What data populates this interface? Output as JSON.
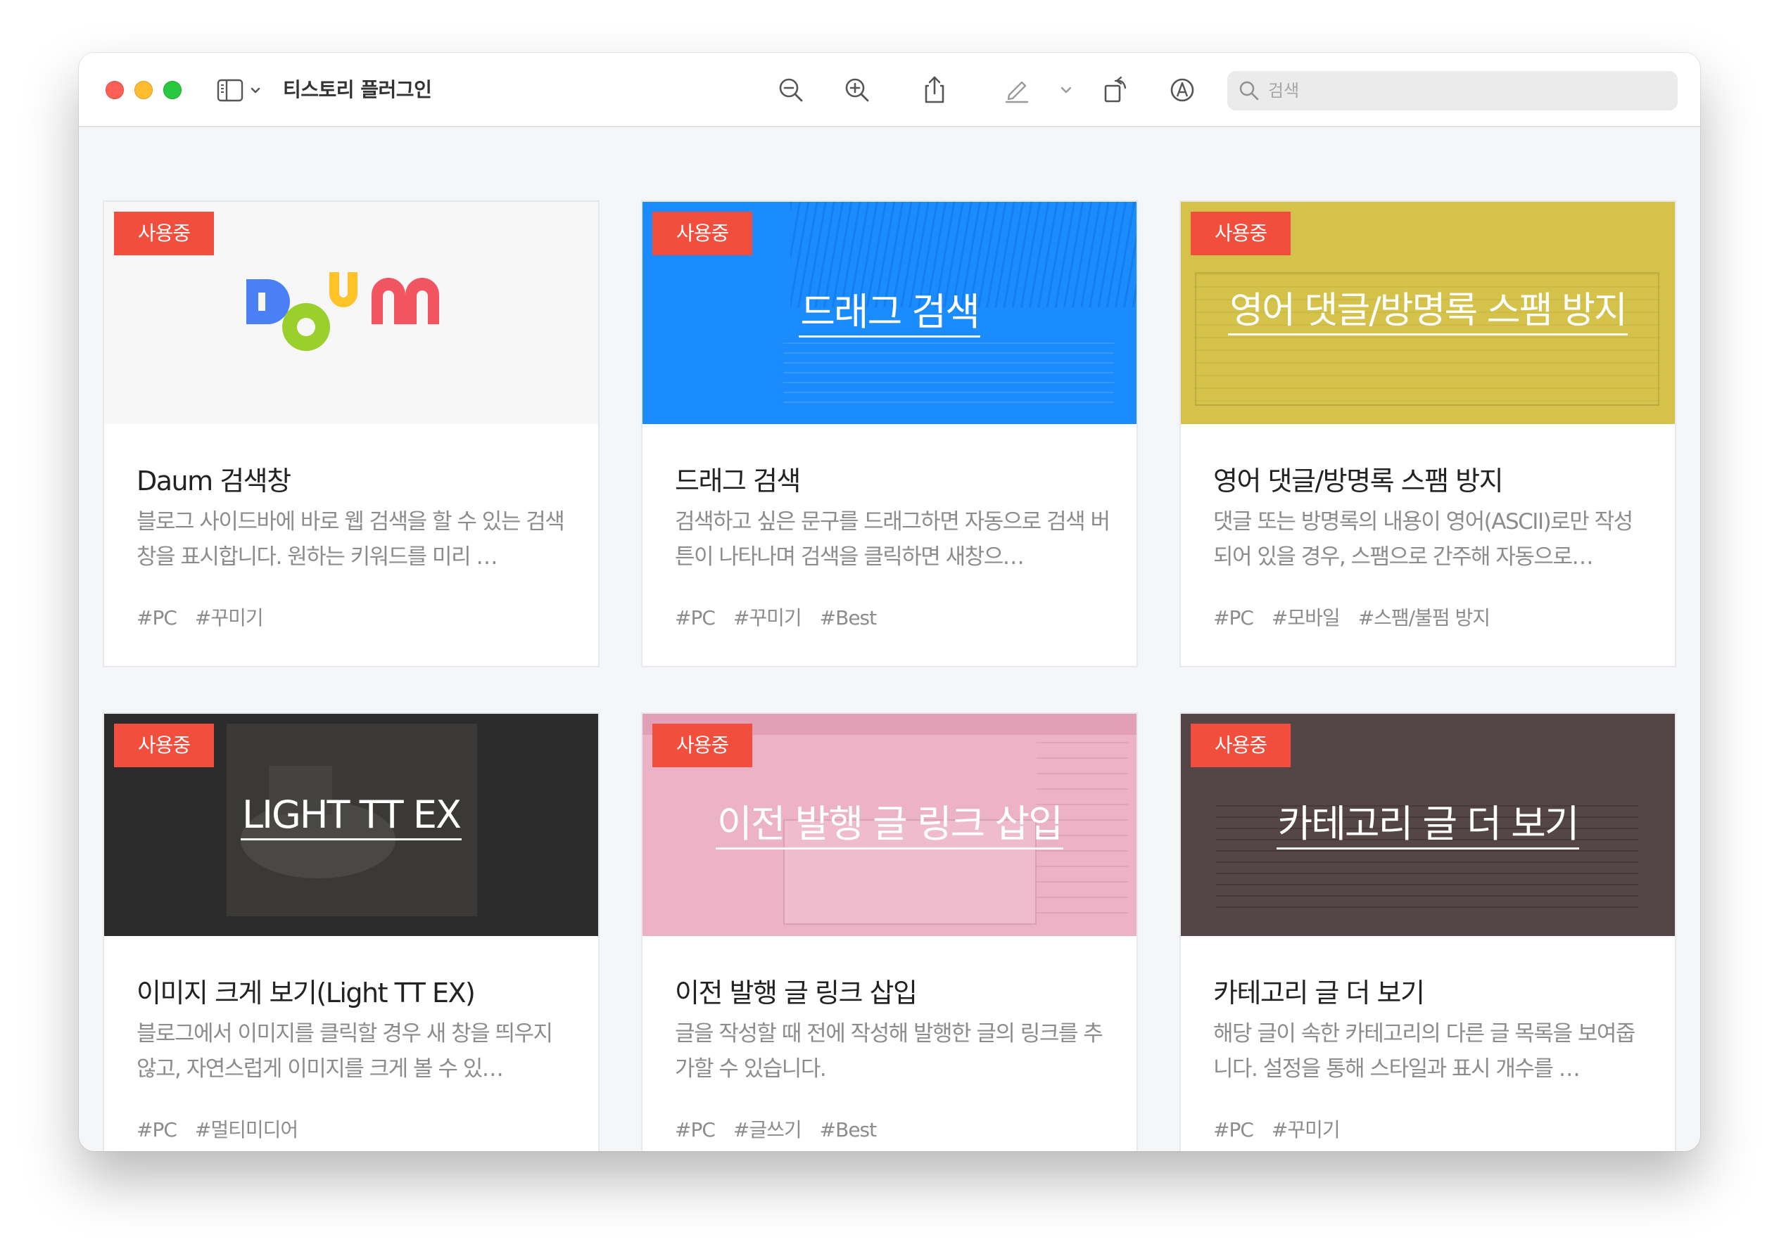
{
  "window": {
    "title": "티스토리 플러그인"
  },
  "search": {
    "placeholder": "검색"
  },
  "toolbar": {
    "icons": [
      "sidebar-icon",
      "zoom-out-icon",
      "zoom-in-icon",
      "share-icon",
      "highlight-icon",
      "rotate-icon",
      "markup-icon",
      "search-icon"
    ]
  },
  "colors": {
    "badge": "#f24e3e",
    "drag_bg": "#1a8cff",
    "spam_bg": "#d4c24a",
    "light_bg": "#2c2c2c",
    "link_bg": "#ecb3c7",
    "category_bg": "#544646"
  },
  "cards": [
    {
      "badge": "사용중",
      "thumb_logo": "Daum",
      "title": "Daum 검색창",
      "desc": "블로그 사이드바에 바로 웹 검색을 할 수 있는 검색창을 표시합니다. 원하는 키워드를 미리 …",
      "tags": [
        "#PC",
        "#꾸미기"
      ]
    },
    {
      "badge": "사용중",
      "thumb_title": "드래그 검색",
      "title": "드래그 검색",
      "desc": "검색하고 싶은 문구를 드래그하면 자동으로 검색 버튼이 나타나며 검색을 클릭하면 새창으…",
      "tags": [
        "#PC",
        "#꾸미기",
        "#Best"
      ]
    },
    {
      "badge": "사용중",
      "thumb_title": "영어 댓글/방명록 스팸 방지",
      "title": "영어 댓글/방명록 스팸 방지",
      "desc": "댓글 또는 방명록의 내용이 영어(ASCII)로만 작성되어 있을 경우, 스팸으로 간주해 자동으로…",
      "tags": [
        "#PC",
        "#모바일",
        "#스팸/불펌 방지"
      ]
    },
    {
      "badge": "사용중",
      "thumb_title": "LIGHT TT EX",
      "title": "이미지 크게 보기(Light TT EX)",
      "desc": "블로그에서 이미지를 클릭할 경우 새 창을 띄우지 않고, 자연스럽게 이미지를 크게 볼 수 있…",
      "tags": [
        "#PC",
        "#멀티미디어"
      ]
    },
    {
      "badge": "사용중",
      "thumb_title": "이전 발행 글 링크 삽입",
      "title": "이전 발행 글 링크 삽입",
      "desc": "글을 작성할 때 전에 작성해 발행한 글의 링크를 추가할 수 있습니다.",
      "tags": [
        "#PC",
        "#글쓰기",
        "#Best"
      ]
    },
    {
      "badge": "사용중",
      "thumb_title": "카테고리 글 더 보기",
      "title": "카테고리 글 더 보기",
      "desc": "해당 글이 속한 카테고리의 다른 글 목록을 보여줍니다. 설정을 통해 스타일과 표시 개수를 …",
      "tags": [
        "#PC",
        "#꾸미기"
      ]
    }
  ]
}
